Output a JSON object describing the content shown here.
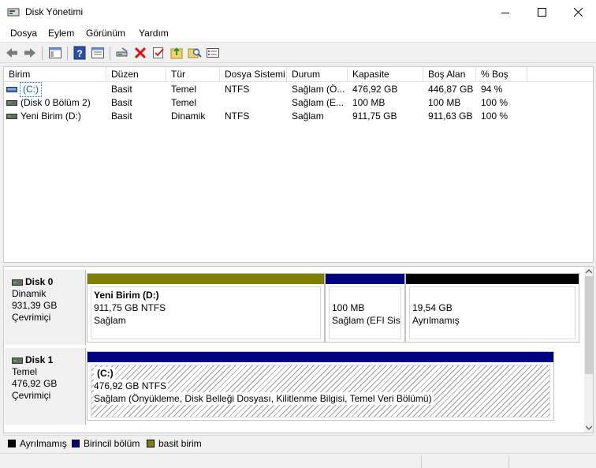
{
  "window": {
    "title": "Disk Yönetimi"
  },
  "menu": [
    "Dosya",
    "Eylem",
    "Görünüm",
    "Yardım"
  ],
  "toolbar_icons": [
    "back-icon",
    "forward-icon",
    "console-tree-icon",
    "help-icon",
    "properties-icon",
    "connect-drive-icon",
    "delete-icon",
    "check-icon",
    "import-icon",
    "search-icon",
    "list-icon"
  ],
  "columns": [
    "Birim",
    "Düzen",
    "Tür",
    "Dosya Sistemi",
    "Durum",
    "Kapasite",
    "Boş Alan",
    "% Boş"
  ],
  "volumes": [
    {
      "name": "(C:)",
      "layout": "Basit",
      "type": "Temel",
      "fs": "NTFS",
      "status": "Sağlam (Ö...",
      "capacity": "476,92 GB",
      "free": "446,87 GB",
      "pct": "94 %",
      "selected": true
    },
    {
      "name": "(Disk 0 Bölüm 2)",
      "layout": "Basit",
      "type": "Temel",
      "fs": "",
      "status": "Sağlam (E...",
      "capacity": "100 MB",
      "free": "100 MB",
      "pct": "100 %",
      "selected": false
    },
    {
      "name": "Yeni Birim (D:)",
      "layout": "Basit",
      "type": "Dinamik",
      "fs": "NTFS",
      "status": "Sağlam",
      "capacity": "911,75 GB",
      "free": "911,63 GB",
      "pct": "100 %",
      "selected": false
    }
  ],
  "disks": [
    {
      "name": "Disk 0",
      "kind": "Dinamik",
      "size": "931,39 GB",
      "state": "Çevrimiçi",
      "partitions": [
        {
          "title": "Yeni Birim  (D:)",
          "line1": "911,75 GB NTFS",
          "line2": "Sağlam",
          "bar_color": "#808000"
        },
        {
          "title": "",
          "line1": "100 MB",
          "line2": "Sağlam (EFI Siste",
          "bar_color": "#000080"
        },
        {
          "title": "",
          "line1": "19,54 GB",
          "line2": "Ayrılmamış",
          "bar_color": "#000000"
        }
      ]
    },
    {
      "name": "Disk 1",
      "kind": "Temel",
      "size": "476,92 GB",
      "state": "Çevrimiçi",
      "partitions": [
        {
          "title": "(C:)",
          "line1": "476,92 GB NTFS",
          "line2": "Sağlam (Önyükleme, Disk Belleği Dosyası, Kilitlenme Bilgisi, Temel Veri Bölümü)",
          "bar_color": "#000080"
        }
      ]
    }
  ],
  "legend": [
    {
      "label": "Ayrılmamış",
      "color": "#000000"
    },
    {
      "label": "Birincil bölüm",
      "color": "#000080"
    },
    {
      "label": "basit birim",
      "color": "#808000"
    }
  ]
}
